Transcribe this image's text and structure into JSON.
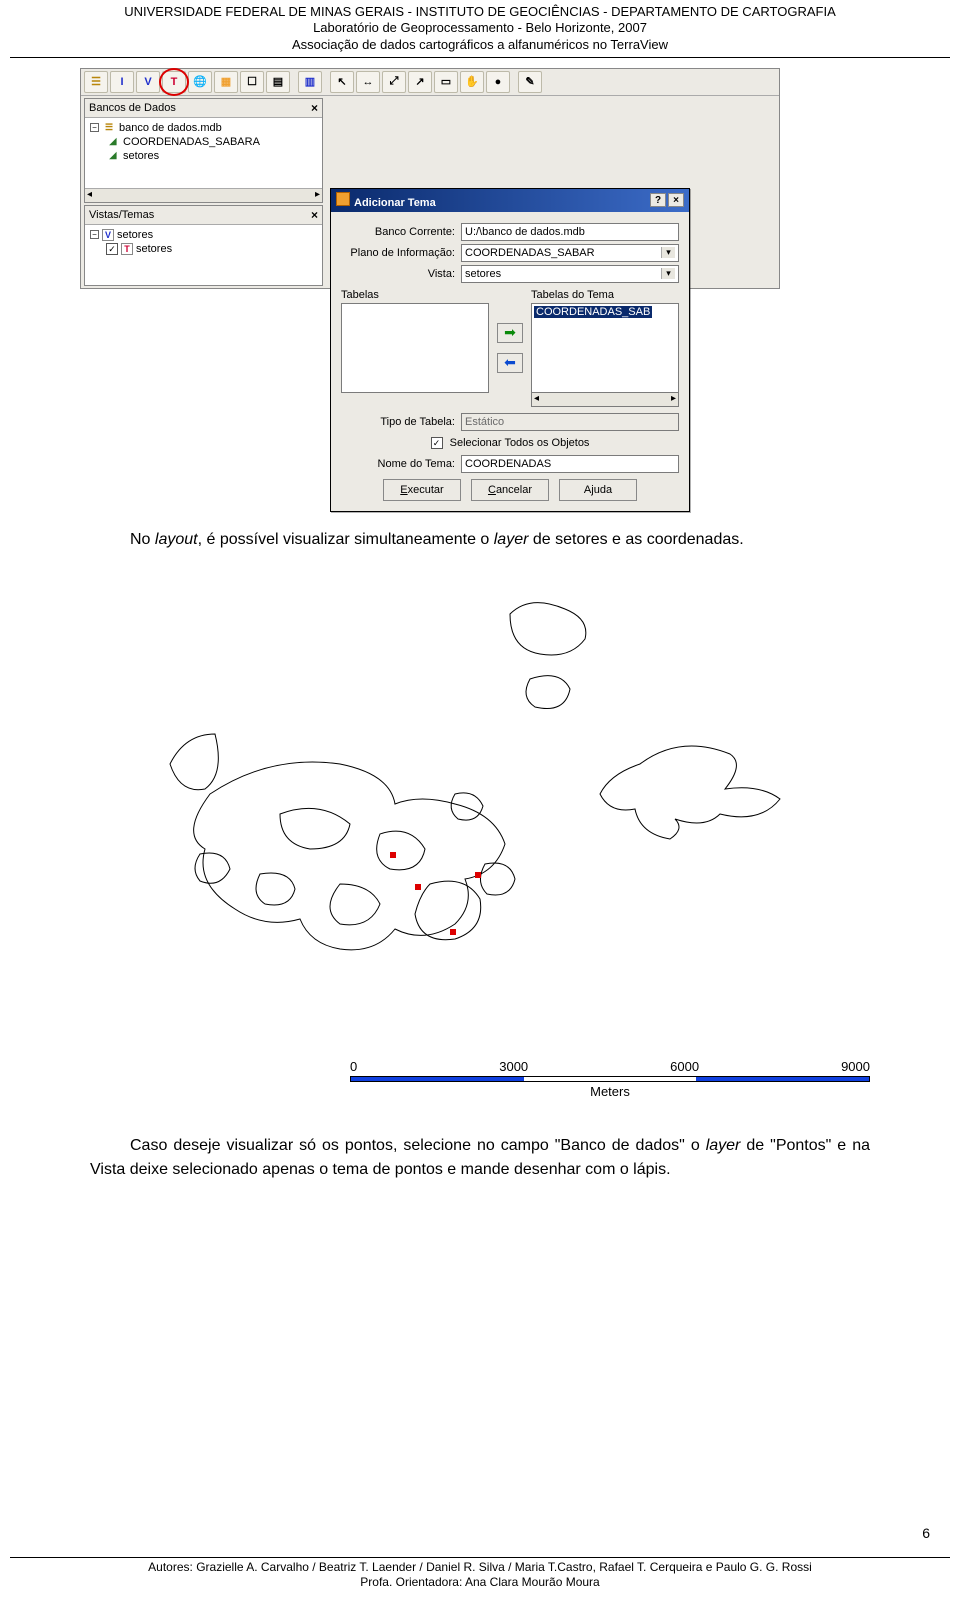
{
  "header": {
    "line1": "UNIVERSIDADE FEDERAL DE MINAS GERAIS - INSTITUTO DE GEOCIÊNCIAS - DEPARTAMENTO DE CARTOGRAFIA",
    "line2": "Laboratório de Geoprocessamento - Belo Horizonte, 2007",
    "line3": "Associação de dados cartográficos a alfanuméricos no TerraView"
  },
  "screenshot": {
    "toolbar_icons": [
      "db-icon",
      "i-icon",
      "v-icon",
      "t-icon",
      "world-icon",
      "layer-icon",
      "display-icon",
      "multi-icon",
      "layout-icon",
      "sep",
      "arrow-icon",
      "hand-icon",
      "info-icon",
      "info2-icon",
      "rect-icon",
      "circle-icon",
      "poly-icon",
      "sep",
      "pencil-icon"
    ],
    "circled_icon_index": 3,
    "panel_db": {
      "title": "Bancos de Dados",
      "root": "banco de dados.mdb",
      "children": [
        "COORDENADAS_SABARA",
        "setores"
      ]
    },
    "panel_views": {
      "title": "Vistas/Temas",
      "root": "setores",
      "children": [
        "setores"
      ]
    }
  },
  "dialog": {
    "title": "Adicionar Tema",
    "fields": {
      "banco_label": "Banco Corrente:",
      "banco_value": "U:/\\banco de dados.mdb",
      "plano_label": "Plano de Informação:",
      "plano_value": "COORDENADAS_SABAR",
      "vista_label": "Vista:",
      "vista_value": "setores",
      "tabelas_label": "Tabelas",
      "tabelas_tema_label": "Tabelas do Tema",
      "tabelas_tema_item": "COORDENADAS_SAB",
      "tipo_label": "Tipo de Tabela:",
      "tipo_value": "Estático",
      "select_all_label": "Selecionar Todos os Objetos",
      "nome_label": "Nome do Tema:",
      "nome_value": "COORDENADAS"
    },
    "buttons": {
      "exec": "Executar",
      "cancel": "Cancelar",
      "help": "Ajuda"
    }
  },
  "body": {
    "para1_a": "No ",
    "para1_b": "layout",
    "para1_c": ", é possível visualizar simultaneamente o ",
    "para1_d": "layer",
    "para1_e": " de setores e as coordenadas.",
    "para2_a": "Caso deseje visualizar só os pontos, selecione no campo \"Banco de dados\" o ",
    "para2_b": "layer",
    "para2_c": " de \"Pontos\" e na Vista deixe selecionado apenas o tema de pontos e mande desenhar com o lápis."
  },
  "scalebar": {
    "ticks": [
      "0",
      "3000",
      "6000",
      "9000"
    ],
    "unit": "Meters"
  },
  "footer": {
    "line1": "Autores: Grazielle A. Carvalho / Beatriz T. Laender / Daniel R. Silva / Maria T.Castro, Rafael T.  Cerqueira e Paulo G. G. Rossi",
    "line2": "Profa. Orientadora: Ana Clara Mourão Moura"
  },
  "page_number": "6"
}
